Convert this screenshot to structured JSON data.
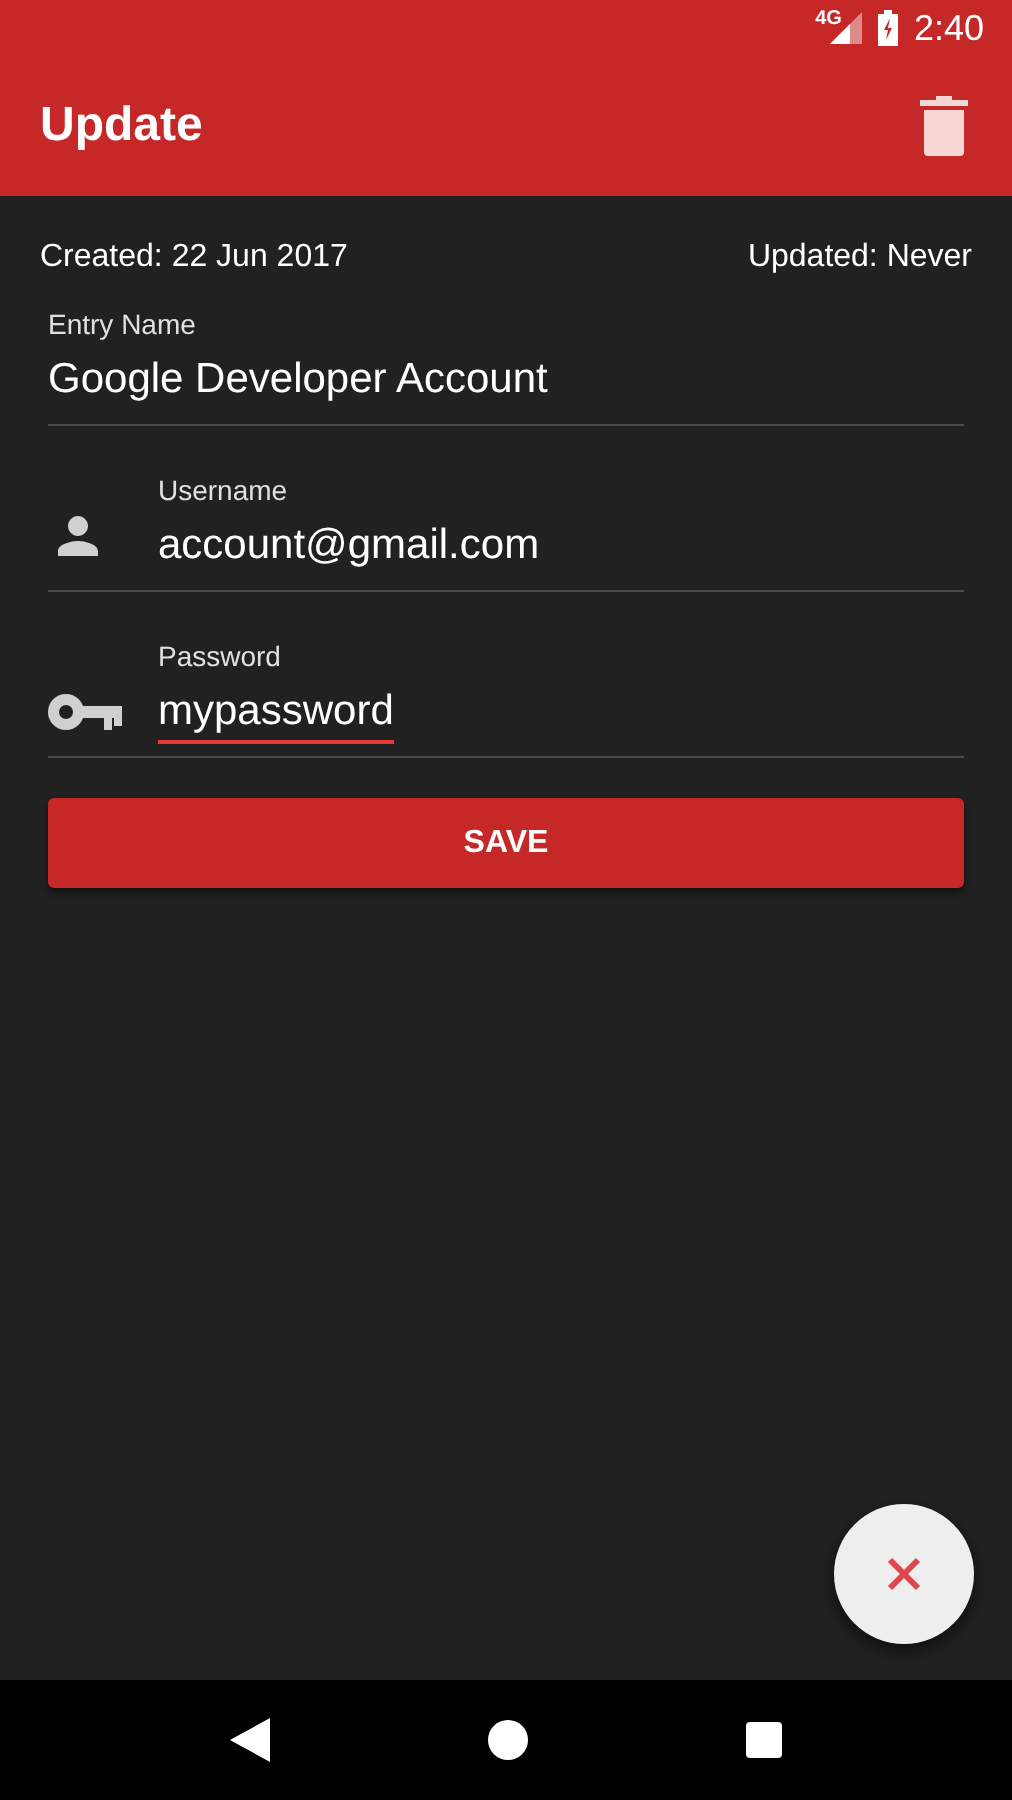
{
  "status_bar": {
    "network": "4G",
    "time": "2:40"
  },
  "app_bar": {
    "title": "Update"
  },
  "meta": {
    "created": "Created: 22 Jun 2017",
    "updated": "Updated: Never"
  },
  "fields": [
    {
      "label": "Entry Name",
      "value": "Google Developer Account",
      "kind": "plain",
      "misspelled": false
    },
    {
      "label": "Username",
      "value": "account@gmail.com",
      "kind": "username",
      "misspelled": false
    },
    {
      "label": "Password",
      "value": "mypassword",
      "kind": "password",
      "misspelled": true
    }
  ],
  "save_button": "SAVE"
}
